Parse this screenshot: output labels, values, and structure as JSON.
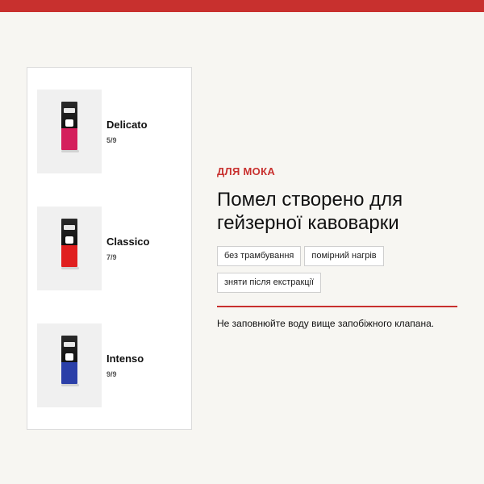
{
  "colors": {
    "accent": "#c8302e",
    "background": "#f7f6f2",
    "delicato": "#d41f5c",
    "classico": "#e01f1f",
    "intenso": "#2b3fa8"
  },
  "products": [
    {
      "name": "Delicato",
      "count": "5/9"
    },
    {
      "name": "Classico",
      "count": "7/9"
    },
    {
      "name": "Intenso",
      "count": "9/9"
    }
  ],
  "section": {
    "eyebrow": "ДЛЯ МОКА",
    "headline": "Помел створено для гейзерної кавоварки",
    "tags": [
      "без трамбування",
      "помірний нагрів",
      "зняти після екстракції"
    ],
    "note": "Не заповнюйте воду вище запобіжного клапана."
  }
}
